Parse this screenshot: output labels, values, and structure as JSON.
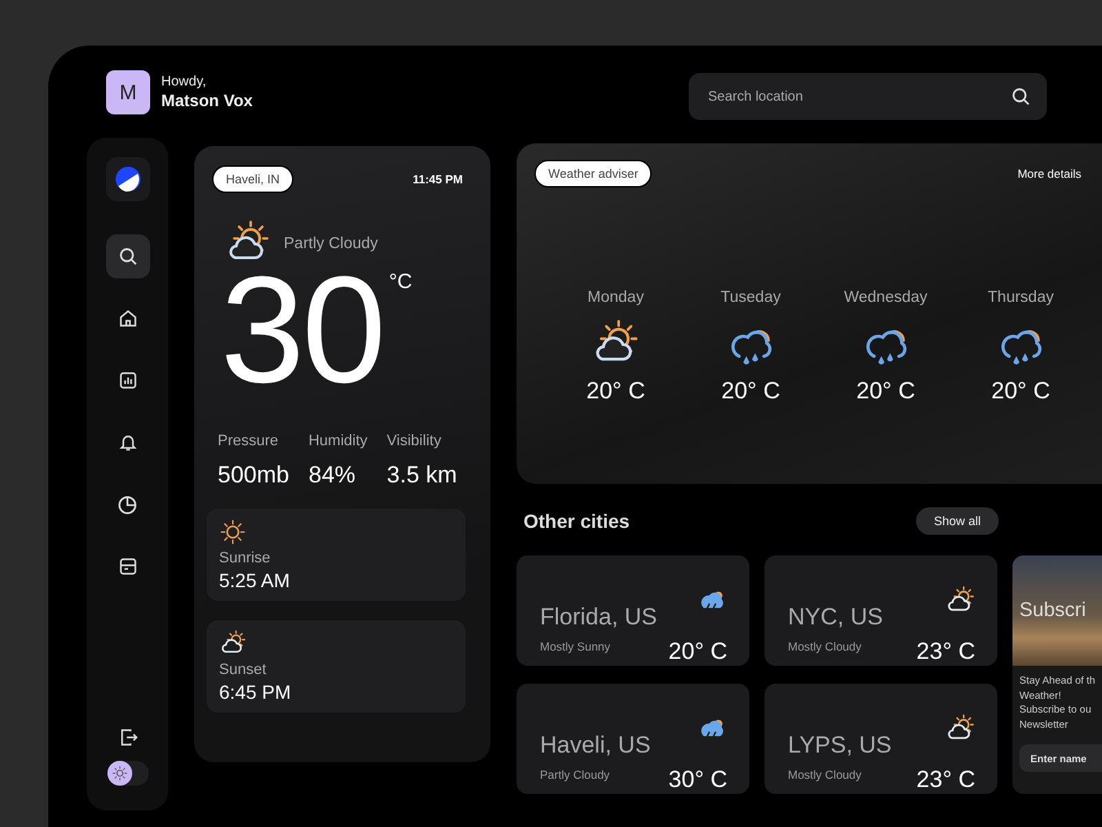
{
  "user": {
    "initial": "M",
    "greeting": "Howdy,",
    "name": "Matson Vox"
  },
  "search": {
    "placeholder": "Search location"
  },
  "sidebar": {
    "items": [
      {
        "kind": "search",
        "selected": true
      },
      {
        "kind": "home",
        "selected": false
      },
      {
        "kind": "chart",
        "selected": false
      },
      {
        "kind": "bell",
        "selected": false
      },
      {
        "kind": "pie",
        "selected": false
      },
      {
        "kind": "box",
        "selected": false
      }
    ],
    "dark_mode": {
      "on": false
    }
  },
  "current": {
    "location": "Haveli, IN",
    "time": "11:45 PM",
    "condition": "Partly Cloudy",
    "temperature": "30",
    "unit": "°C",
    "stats": [
      {
        "label": "Pressure",
        "value": "500mb"
      },
      {
        "label": "Humidity",
        "value": "84%"
      },
      {
        "label": "Visibility",
        "value": "3.5  km"
      }
    ],
    "sun_events": [
      {
        "kind": "sunrise",
        "label": "Sunrise",
        "time": "5:25 AM"
      },
      {
        "kind": "sunset",
        "label": "Sunset",
        "time": "6:45 PM"
      }
    ]
  },
  "adviser": {
    "badge": "Weather adviser",
    "link": "More details",
    "days": [
      {
        "day": "Monday",
        "kind": "partly-cloudy",
        "temp": "20° C"
      },
      {
        "day": "Tuseday",
        "kind": "rain",
        "temp": "20° C"
      },
      {
        "day": "Wednesday",
        "kind": "rain",
        "temp": "20° C"
      },
      {
        "day": "Thursday",
        "kind": "rain",
        "temp": "20° C"
      }
    ]
  },
  "other_cities": {
    "title": "Other cities",
    "action": "Show all",
    "cities": [
      {
        "name": "Florida, US",
        "condition": "Mostly Sunny",
        "temp": "20° C",
        "kind": "storm"
      },
      {
        "name": "NYC, US",
        "condition": "Mostly Cloudy",
        "temp": "23° C",
        "kind": "cloudy"
      },
      {
        "name": "Haveli, US",
        "condition": "Partly Cloudy",
        "temp": "30° C",
        "kind": "storm"
      },
      {
        "name": "LYPS, US",
        "condition": "Mostly Cloudy",
        "temp": "23° C",
        "kind": "cloudy"
      }
    ]
  },
  "subscribe": {
    "title": "Subscri",
    "lines": [
      "Stay Ahead of th",
      "Weather!",
      "Subscribe to ou",
      "Newsletter"
    ],
    "placeholder": "Enter name"
  }
}
